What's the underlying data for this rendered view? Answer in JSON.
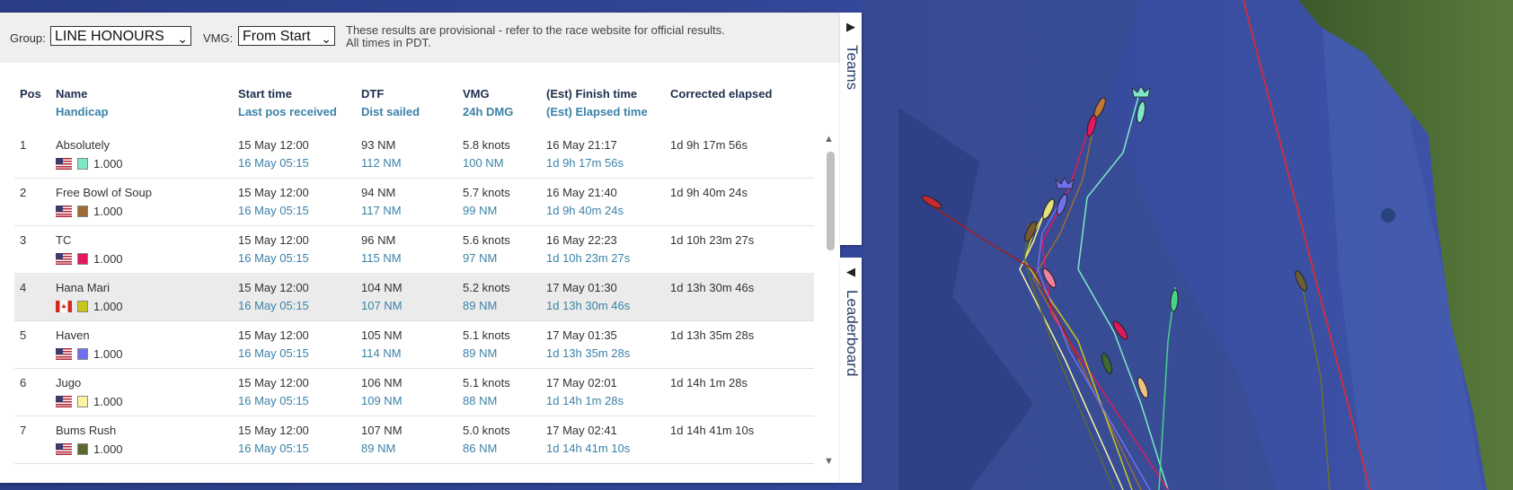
{
  "filters": {
    "group_label": "Group:",
    "group_value": "LINE HONOURS",
    "vmg_label": "VMG:",
    "vmg_value": "From Start",
    "notice_line1": "These results are provisional - refer to the race website for official results.",
    "notice_line2": "All times in PDT."
  },
  "columns": {
    "pos": "Pos",
    "name": "Name",
    "handicap": "Handicap",
    "start": "Start time",
    "lastpos": "Last pos received",
    "dtf": "DTF",
    "dist": "Dist sailed",
    "vmg": "VMG",
    "dmg": "24h DMG",
    "finish": "(Est) Finish time",
    "elapsed": "(Est) Elapsed time",
    "corrected": "Corrected elapsed"
  },
  "rows": [
    {
      "pos": "1",
      "name": "Absolutely",
      "flag": "US",
      "color": "#7de8c8",
      "handicap": "1.000",
      "start": "15 May 12:00",
      "lastpos": "16 May 05:15",
      "dtf": "93 NM",
      "dist": "112 NM",
      "vmg": "5.8 knots",
      "dmg": "100 NM",
      "finish": "16 May 21:17",
      "elapsed": "1d 9h 17m 56s",
      "corrected": "1d 9h 17m 56s"
    },
    {
      "pos": "2",
      "name": "Free Bowl of Soup",
      "flag": "US",
      "color": "#a06a35",
      "handicap": "1.000",
      "start": "15 May 12:00",
      "lastpos": "16 May 05:15",
      "dtf": "94 NM",
      "dist": "117 NM",
      "vmg": "5.7 knots",
      "dmg": "99 NM",
      "finish": "16 May 21:40",
      "elapsed": "1d 9h 40m 24s",
      "corrected": "1d 9h 40m 24s"
    },
    {
      "pos": "3",
      "name": "TC",
      "flag": "US",
      "color": "#e0195d",
      "handicap": "1.000",
      "start": "15 May 12:00",
      "lastpos": "16 May 05:15",
      "dtf": "96 NM",
      "dist": "115 NM",
      "vmg": "5.6 knots",
      "dmg": "97 NM",
      "finish": "16 May 22:23",
      "elapsed": "1d 10h 23m 27s",
      "corrected": "1d 10h 23m 27s"
    },
    {
      "pos": "4",
      "name": "Hana Mari",
      "flag": "CA",
      "color": "#c8c81a",
      "handicap": "1.000",
      "start": "15 May 12:00",
      "lastpos": "16 May 05:15",
      "dtf": "104 NM",
      "dist": "107 NM",
      "vmg": "5.2 knots",
      "dmg": "89 NM",
      "finish": "17 May 01:30",
      "elapsed": "1d 13h 30m 46s",
      "corrected": "1d 13h 30m 46s",
      "highlight": true
    },
    {
      "pos": "5",
      "name": "Haven",
      "flag": "US",
      "color": "#7070ee",
      "handicap": "1.000",
      "start": "15 May 12:00",
      "lastpos": "16 May 05:15",
      "dtf": "105 NM",
      "dist": "114 NM",
      "vmg": "5.1 knots",
      "dmg": "89 NM",
      "finish": "17 May 01:35",
      "elapsed": "1d 13h 35m 28s",
      "corrected": "1d 13h 35m 28s"
    },
    {
      "pos": "6",
      "name": "Jugo",
      "flag": "US",
      "color": "#fbf5a0",
      "handicap": "1.000",
      "start": "15 May 12:00",
      "lastpos": "16 May 05:15",
      "dtf": "106 NM",
      "dist": "109 NM",
      "vmg": "5.1 knots",
      "dmg": "88 NM",
      "finish": "17 May 02:01",
      "elapsed": "1d 14h 1m 28s",
      "corrected": "1d 14h 1m 28s"
    },
    {
      "pos": "7",
      "name": "Bums Rush",
      "flag": "US",
      "color": "#5a6a30",
      "handicap": "1.000",
      "start": "15 May 12:00",
      "lastpos": "16 May 05:15",
      "dtf": "107 NM",
      "dist": "89 NM",
      "vmg": "5.0 knots",
      "dmg": "86 NM",
      "finish": "17 May 02:41",
      "elapsed": "1d 14h 41m 10s",
      "corrected": "1d 14h 41m 10s"
    }
  ],
  "tabs": {
    "teams": "Teams",
    "leaderboard": "Leaderboard"
  },
  "icons": {
    "teams_arrow": "play-right",
    "leaderboard_arrow": "play-left",
    "scroll_up": "triangle-up",
    "scroll_down": "triangle-down",
    "leader_marker": "crown"
  }
}
